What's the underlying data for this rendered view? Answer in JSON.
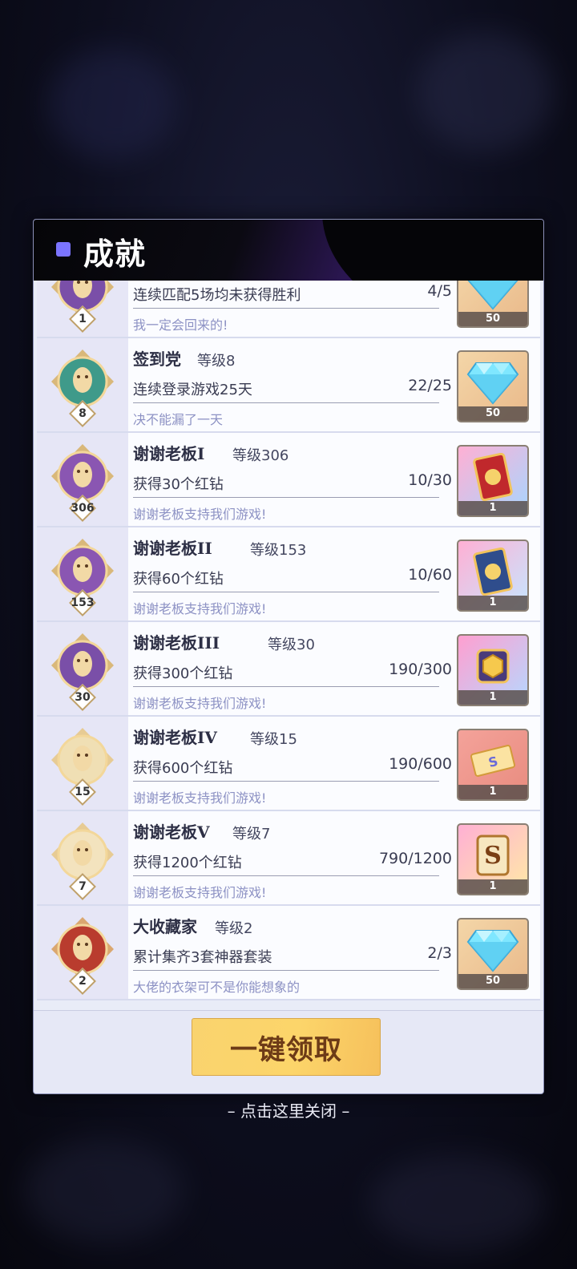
{
  "modal": {
    "title": "成就",
    "claim_all_label": "一键领取",
    "close_hint": "– 点击这里关闭 –"
  },
  "achievements": [
    {
      "name": "",
      "level": "",
      "level_badge": "1",
      "desc": "连续匹配5场均未获得胜利",
      "progress": "4/5",
      "flavor": "我一定会回来的!",
      "reward": {
        "type": "diamond-icon",
        "qty": "50"
      }
    },
    {
      "name": "签到党",
      "level": "等级8",
      "level_badge": "8",
      "desc": "连续登录游戏25天",
      "progress": "22/25",
      "flavor": "决不能漏了一天",
      "reward": {
        "type": "diamond-icon",
        "qty": "50"
      }
    },
    {
      "name": "谢谢老板I",
      "level": "等级306",
      "level_badge": "306",
      "desc": "获得30个红钻",
      "progress": "10/30",
      "flavor": "谢谢老板支持我们游戏!",
      "reward": {
        "type": "red-card-icon",
        "qty": "1"
      }
    },
    {
      "name": "谢谢老板II",
      "level": "等级153",
      "level_badge": "153",
      "desc": "获得60个红钻",
      "progress": "10/60",
      "flavor": "谢谢老板支持我们游戏!",
      "reward": {
        "type": "blue-card-icon",
        "qty": "1"
      }
    },
    {
      "name": "谢谢老板III",
      "level": "等级30",
      "level_badge": "30",
      "desc": "获得300个红钻",
      "progress": "190/300",
      "flavor": "谢谢老板支持我们游戏!",
      "reward": {
        "type": "gold-box-icon",
        "qty": "1"
      }
    },
    {
      "name": "谢谢老板IV",
      "level": "等级15",
      "level_badge": "15",
      "desc": "获得600个红钻",
      "progress": "190/600",
      "flavor": "谢谢老板支持我们游戏!",
      "reward": {
        "type": "ticket-icon",
        "qty": "1"
      }
    },
    {
      "name": "谢谢老板V",
      "level": "等级7",
      "level_badge": "7",
      "desc": "获得1200个红钻",
      "progress": "790/1200",
      "flavor": "谢谢老板支持我们游戏!",
      "reward": {
        "type": "s-card-icon",
        "qty": "1"
      }
    },
    {
      "name": "大收藏家",
      "level": "等级2",
      "level_badge": "2",
      "desc": "累计集齐3套神器套装",
      "progress": "2/3",
      "flavor": "大佬的衣架可不是你能想象的",
      "reward": {
        "type": "diamond-icon",
        "qty": "50"
      }
    }
  ],
  "colors": {
    "accent": "#7b74ff",
    "button": "#fcd56a",
    "button_text": "#6d3b17",
    "flavor_text": "#8d92c4"
  }
}
